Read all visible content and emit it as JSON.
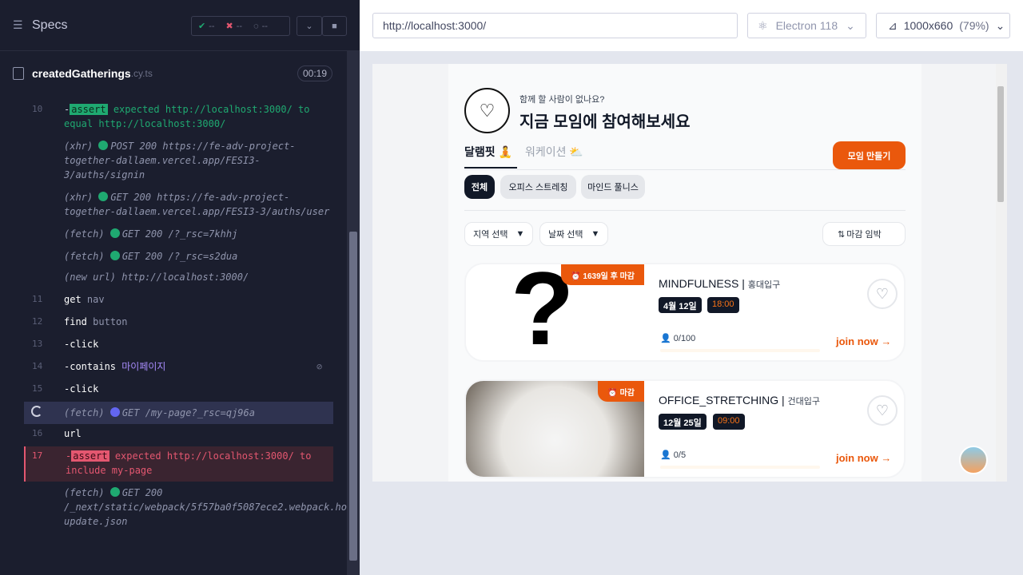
{
  "runner": {
    "specs_label": "Specs",
    "stats": {
      "passed": "--",
      "failed": "--",
      "pending": "--"
    },
    "file": {
      "name": "createdGatherings",
      "ext": ".cy.ts",
      "duration": "00:19"
    },
    "log": [
      {
        "num": "10",
        "text_pre": "-",
        "badge": "assert",
        "text": "expected http://localhost:3000/ to equal http://localhost:3000/"
      },
      {
        "num": "",
        "kind": "(xhr)",
        "text": "POST 200 https://fe-adv-project-together-dallaem.vercel.app/FESI3-3/auths/signin"
      },
      {
        "num": "",
        "kind": "(xhr)",
        "text": "GET 200 https://fe-adv-project-together-dallaem.vercel.app/FESI3-3/auths/user"
      },
      {
        "num": "",
        "kind": "(fetch)",
        "text": "GET 200 /?_rsc=7khhj"
      },
      {
        "num": "",
        "kind": "(fetch)",
        "text": "GET 200 /?_rsc=s2dua"
      },
      {
        "num": "",
        "kind": "(new url)",
        "text": "http://localhost:3000/"
      },
      {
        "num": "11",
        "cmd": "get",
        "arg": "nav"
      },
      {
        "num": "12",
        "cmd": "find",
        "arg": "button"
      },
      {
        "num": "13",
        "cmd": "-click",
        "arg": ""
      },
      {
        "num": "14",
        "cmd": "-contains",
        "arg": "마이페이지"
      },
      {
        "num": "15",
        "cmd": "-click",
        "arg": ""
      },
      {
        "num": "",
        "kind": "(fetch)",
        "text": "GET /my-page?_rsc=qj96a"
      },
      {
        "num": "16",
        "cmd": "url",
        "arg": ""
      },
      {
        "num": "17",
        "text_pre": "-",
        "badge": "assert",
        "text": "expected http://localhost:3000/ to include my-page"
      },
      {
        "num": "",
        "kind": "(fetch)",
        "text": "GET 200 /_next/static/webpack/5f57ba0f5087ece2.webpack.hot-update.json"
      }
    ]
  },
  "browser": {
    "url": "http://localhost:3000/",
    "engine": "Electron 118",
    "viewport": "1000x660",
    "zoom": "(79%)"
  },
  "app": {
    "subhead": "함께 할 사람이 없나요?",
    "headline": "지금 모임에 참여해보세요",
    "tabs": [
      "달램핏",
      "워케이션"
    ],
    "create_button": "모임 만들기",
    "chips": [
      "전체",
      "오피스 스트레칭",
      "마인드 풀니스"
    ],
    "filters": {
      "region": "지역 선택",
      "date": "날짜 선택",
      "sort": "마감 임박"
    },
    "cards": [
      {
        "badge": "1639일 후 마감",
        "title": "MINDFULNESS",
        "location": "홍대입구",
        "date": "4월 12일",
        "time": "18:00",
        "people": "0/100",
        "join": "join now"
      },
      {
        "badge": "마감",
        "title": "OFFICE_STRETCHING",
        "location": "건대입구",
        "date": "12월 25일",
        "time": "09:00",
        "people": "0/5",
        "join": "join now"
      }
    ]
  }
}
